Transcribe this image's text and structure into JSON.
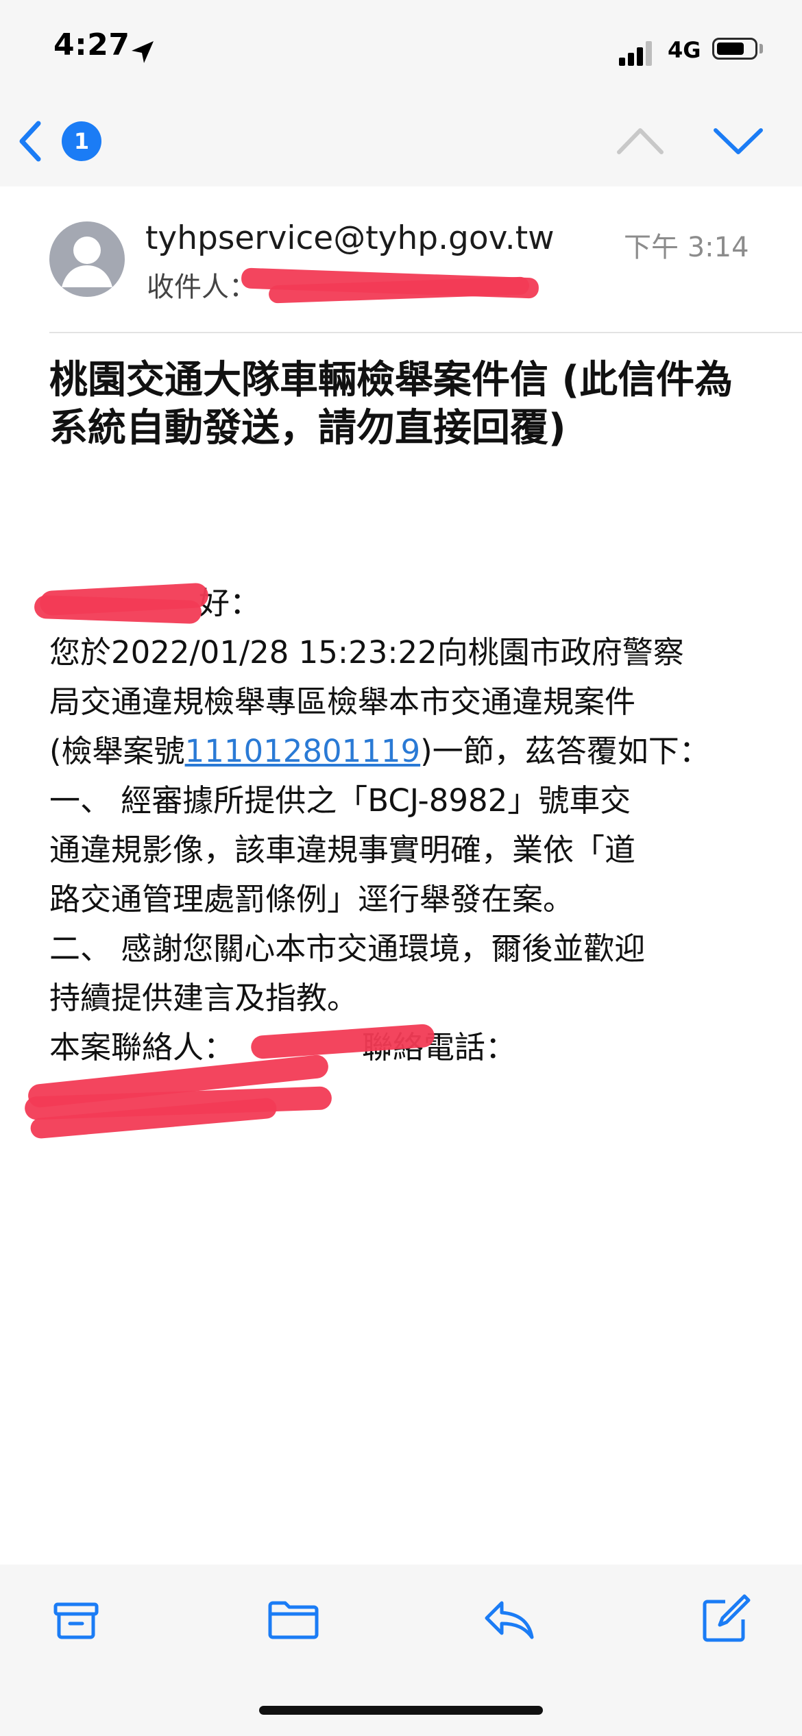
{
  "status_bar": {
    "time": "4:27",
    "carrier": "4G",
    "battery_level": 0.72,
    "signal_bars": 3
  },
  "nav": {
    "unread_count": "1",
    "accent_color": "#1b7cf5"
  },
  "email": {
    "sender": "tyhpservice@tyhp.gov.tw",
    "time": "下午 3:14",
    "recipient_label": "收件人：",
    "subject": "桃園交通大隊車輛檢舉案件信 (此信件為系統自動發送，請勿直接回覆)",
    "body": {
      "greeting": "好：",
      "line1": "您於2022/01/28 15:23:22向桃園市政府警察",
      "line2": "局交通違規檢舉專區檢舉本市交通違規案件",
      "line3_prefix": "(檢舉案號",
      "case_number": "111012801119",
      "line3_suffix": ")一節，茲答覆如下：",
      "line4": "一、 經審據所提供之「BCJ-8982」號車交",
      "line5": "通違規影像，該車違規事實明確，業依「道",
      "line6": "路交通管理處罰條例」逕行舉發在案。",
      "line7": "二、 感謝您關心本市交通環境，爾後並歡迎",
      "line8": "持續提供建言及指教。",
      "contact_label": "本案聯絡人：",
      "phone_label": "聯絡電話："
    }
  },
  "toolbar": {
    "icons": [
      "archive-icon",
      "folder-icon",
      "reply-icon",
      "compose-icon"
    ],
    "icon_color": "#1b7cf5"
  }
}
